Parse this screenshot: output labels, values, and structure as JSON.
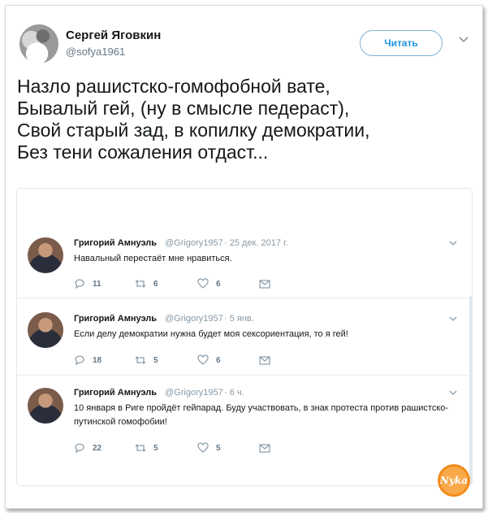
{
  "tweet": {
    "author_name": "Сергей Яговкин",
    "author_handle": "@sofya1961",
    "follow_label": "Читать",
    "lines": [
      "Назло рашистско-гомофобной вате,",
      "Бывалый гей, (ну в смысле педераст),",
      "Свой старый зад, в копилку демократии,",
      "Без тени сожаления отдаст..."
    ]
  },
  "replies": [
    {
      "name": "Григорий Амнуэль",
      "handle": "@Grigory1957",
      "time": "· 25 дек. 2017 г.",
      "text": "Навальный перестаёт мне нравиться.",
      "replies_count": "11",
      "retweets_count": "6",
      "likes_count": "6"
    },
    {
      "name": "Григорий Амнуэль",
      "handle": "@Grigory1957",
      "time": "· 5 янв.",
      "text": "Если делу демократии нужна будет моя сексориентация, то я гей!",
      "replies_count": "18",
      "retweets_count": "5",
      "likes_count": "6"
    },
    {
      "name": "Григорий Амнуэль",
      "handle": "@Grigory1957",
      "time": "· 6 ч.",
      "text": "10 января в Риге пройдёт гейпарад. Буду участвовать, в знак протеста против рашистско-путинской гомофобии!",
      "replies_count": "22",
      "retweets_count": "5",
      "likes_count": "5"
    }
  ],
  "watermark": {
    "text": "Nyka"
  },
  "colors": {
    "accent": "#1b95e0",
    "muted": "#657786",
    "border": "#e1e8ed"
  }
}
